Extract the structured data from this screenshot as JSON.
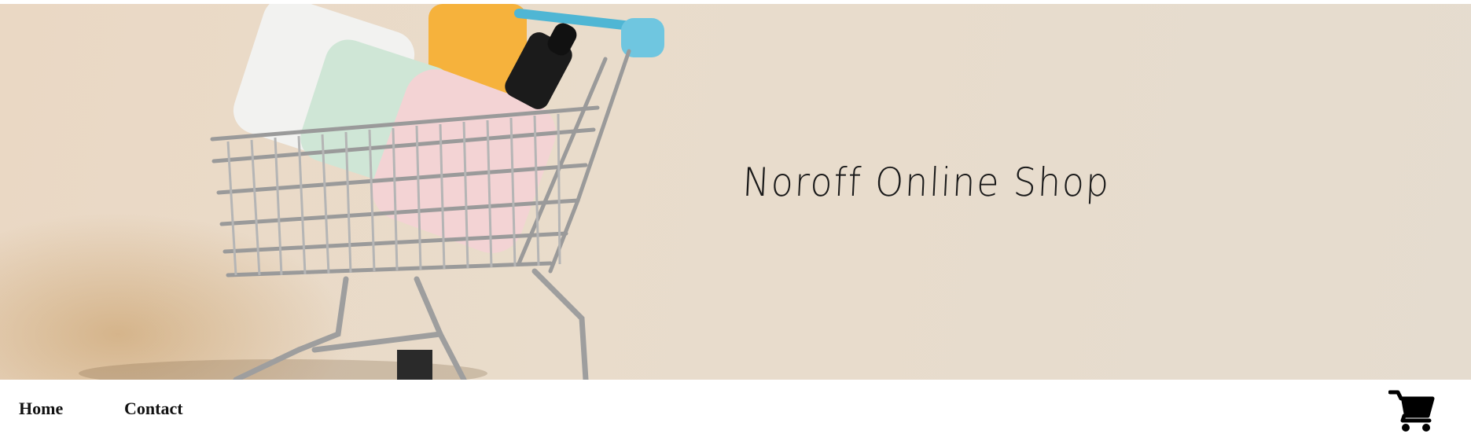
{
  "hero": {
    "title": "Noroff Online Shop"
  },
  "nav": {
    "items": [
      {
        "label": "Home"
      },
      {
        "label": "Contact"
      }
    ],
    "cart_icon": "shopping-cart-icon"
  },
  "colors": {
    "hero_background": "#e8dccd",
    "text": "#111111",
    "nav_background": "#ffffff"
  }
}
